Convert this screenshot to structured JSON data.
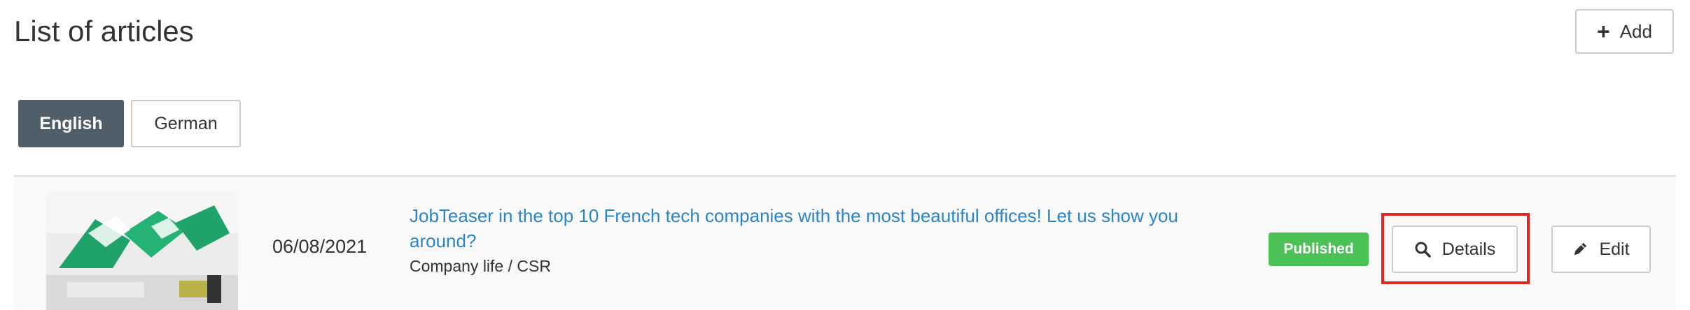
{
  "header": {
    "title": "List of articles",
    "add_label": "Add",
    "add_icon": "plus-icon"
  },
  "languages": [
    {
      "label": "English",
      "selected": true
    },
    {
      "label": "German",
      "selected": false
    }
  ],
  "articles": [
    {
      "date": "06/08/2021",
      "title": "JobTeaser in the top 10 French tech companies with the most beautiful offices! Let us show you around?",
      "category": "Company life / CSR",
      "status": "Published",
      "details_label": "Details",
      "details_icon": "search-icon",
      "edit_label": "Edit",
      "edit_icon": "pencil-icon"
    }
  ],
  "colors": {
    "active_tab": "#4f5e69",
    "link": "#2a86c7",
    "published_badge": "#4cc158",
    "highlight": "#e3261d"
  }
}
